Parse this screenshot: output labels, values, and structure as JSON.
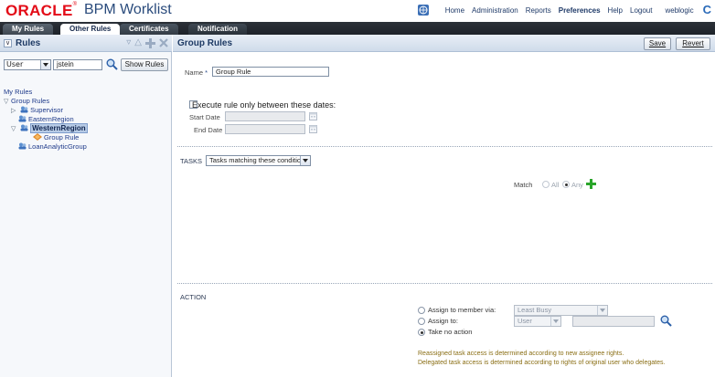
{
  "header": {
    "brand": "ORACLE",
    "app_title": "BPM Worklist",
    "nav": {
      "home": "Home",
      "administration": "Administration",
      "reports": "Reports",
      "preferences": "Preferences",
      "help": "Help",
      "logout": "Logout"
    },
    "user": "weblogic",
    "brand_icon_letter": "C"
  },
  "tabs": [
    {
      "label": "My Rules",
      "active": false
    },
    {
      "label": "Other Rules",
      "active": true
    },
    {
      "label": "Certificates",
      "active": false
    },
    {
      "label": "Notification",
      "active": false
    }
  ],
  "left_panel": {
    "title": "Rules",
    "collapse_glyph": "∨",
    "user_select_value": "User",
    "user_field_value": "jstein",
    "show_rules_label": "Show Rules",
    "tree": {
      "my_rules": "My Rules",
      "group_rules": "Group Rules",
      "items": {
        "supervisor": "Supervisor",
        "eastern": "EasternRegion",
        "western": "WesternRegion",
        "group_rule": "Group Rule",
        "loan": "LoanAnalyticGroup"
      }
    }
  },
  "right_panel": {
    "title": "Group Rules",
    "save_label": "Save",
    "revert_label": "Revert",
    "name_label": "Name",
    "required_mark": "*",
    "name_value": "Group Rule",
    "exec_label": "Execute rule only between these dates:",
    "start_date_label": "Start Date",
    "end_date_label": "End Date",
    "tasks_label": "TASKS",
    "tasks_select_value": "Tasks matching these conditions",
    "match_label": "Match",
    "match_all": "All",
    "match_any": "Any",
    "action_label": "ACTION",
    "assign_member_label": "Assign to member via:",
    "assign_member_value": "Least Busy",
    "assign_to_label": "Assign to:",
    "assign_to_value": "User",
    "take_no_action_label": "Take no action",
    "info_line_1": "Reassigned task access is determined according to new assignee rights.",
    "info_line_2": "Delegated task access is determined according to rights of original user who delegates."
  },
  "colors": {
    "oracle_red": "#e30b17",
    "tab_bar_dark": "#1e2329",
    "panel_header": "#cfdbea",
    "link_blue": "#1e3a8a",
    "info_text": "#8a6e14"
  }
}
